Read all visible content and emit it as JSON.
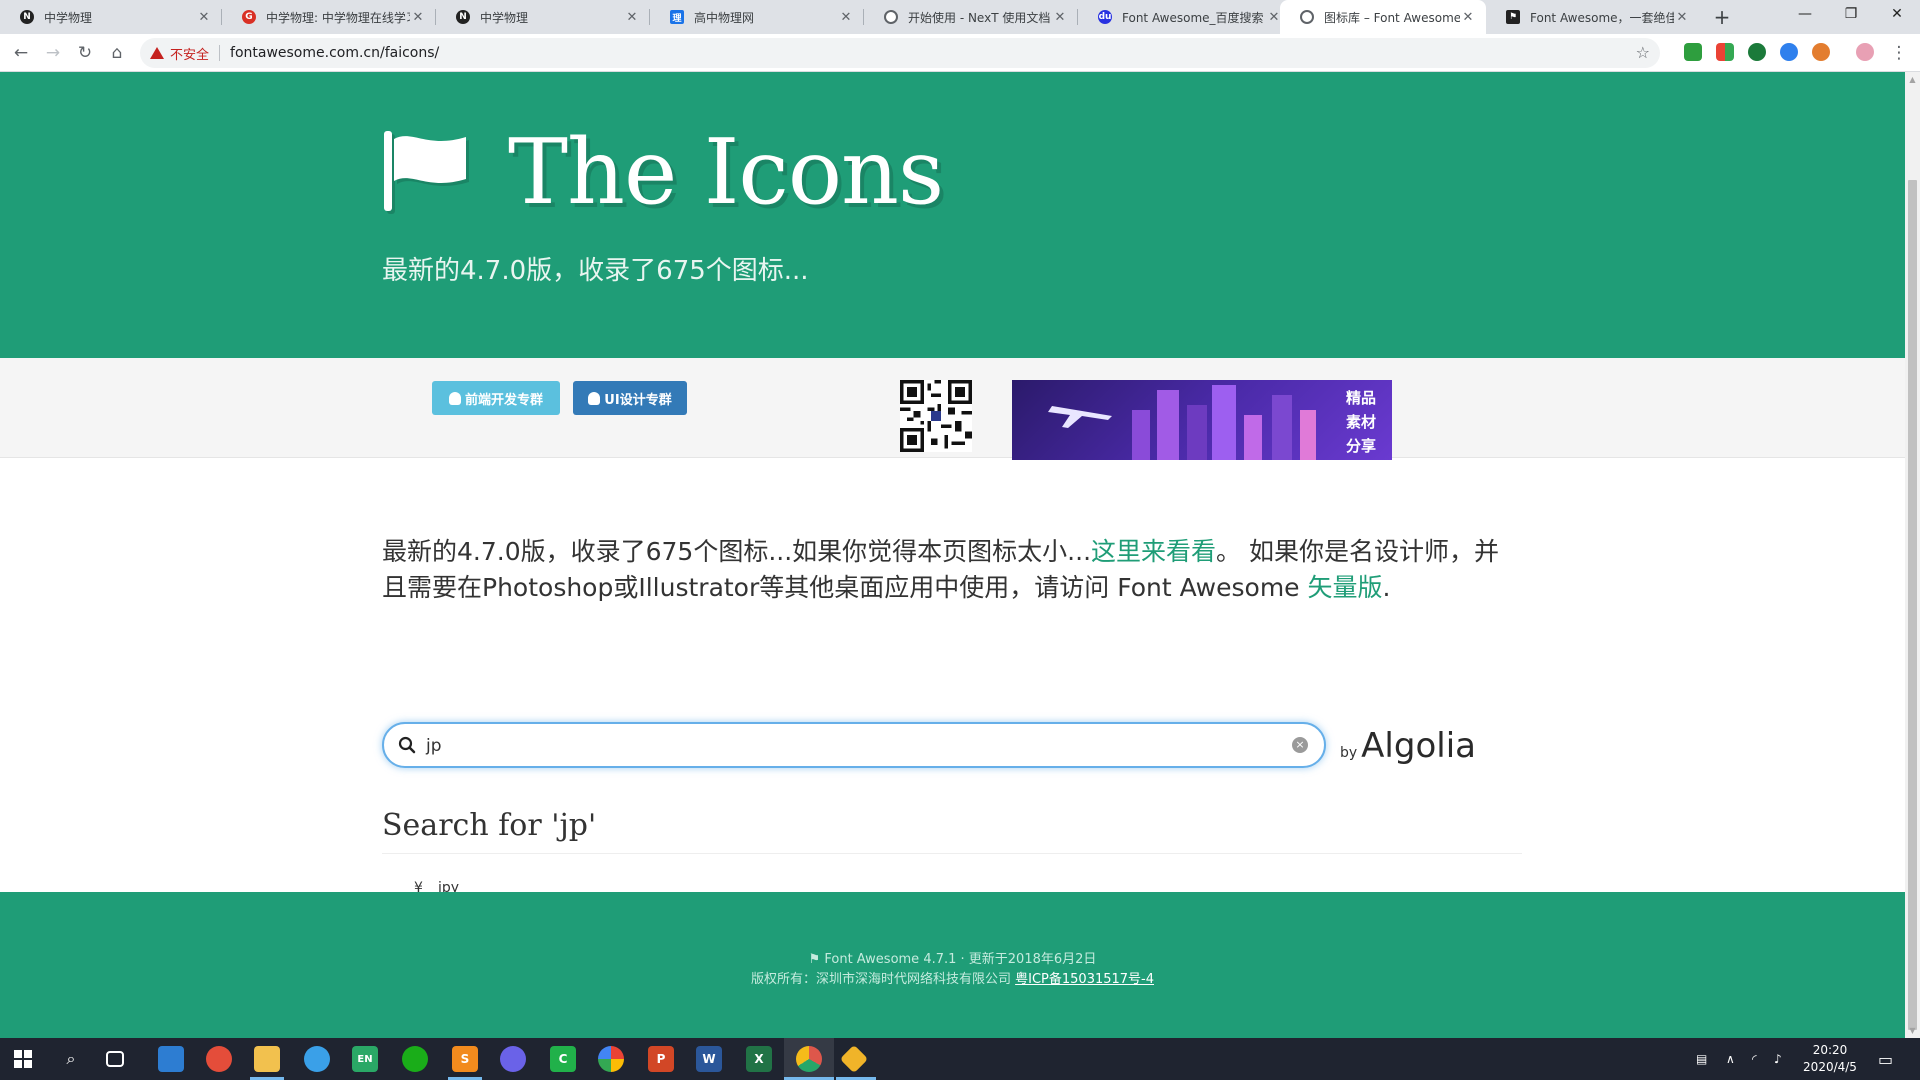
{
  "browser": {
    "tabs": [
      {
        "label": "中学物理",
        "favicon": "notion-icon",
        "color": "#222222"
      },
      {
        "label": "中学物理: 中学物理在线学习",
        "favicon": "g-icon",
        "color": "#d93025"
      },
      {
        "label": "中学物理",
        "favicon": "notion-icon",
        "color": "#222222"
      },
      {
        "label": "高中物理网",
        "favicon": "site-icon",
        "color": "#1a73e8"
      },
      {
        "label": "开始使用 - NexT 使用文档",
        "favicon": "globe-icon",
        "color": "#5f6368"
      },
      {
        "label": "Font Awesome_百度搜索",
        "favicon": "baidu-icon",
        "color": "#2932e1"
      },
      {
        "label": "图标库 – Font Awesome 中",
        "favicon": "globe-icon",
        "color": "#5f6368",
        "active": true
      },
      {
        "label": "Font Awesome，一套绝佳",
        "favicon": "flag-icon",
        "color": "#222222"
      }
    ],
    "new_tab": "+",
    "window_controls": {
      "minimize": "—",
      "maximize": "❐",
      "close": "✕"
    },
    "security_label": "不安全",
    "url": "fontawesome.com.cn/faicons/"
  },
  "page": {
    "title": "The Icons",
    "subtitle": "最新的4.7.0版，收录了675个图标...",
    "group_buttons": [
      {
        "label": "前端开发专群",
        "color": "#5bc0de"
      },
      {
        "label": "UI设计专群",
        "color": "#337ab7"
      }
    ],
    "banner_text": [
      "精品",
      "素材",
      "分享"
    ],
    "intro": {
      "part1": "最新的4.7.0版，收录了675个图标...如果你觉得本页图标太小...",
      "link1": "这里来看看",
      "part2": "。 如果你是名设计师，并且需要在Photoshop或Illustrator等其他桌面应用中使用，请访问 Font Awesome ",
      "link2": "矢量版",
      "part3": "."
    },
    "search": {
      "value": "jp",
      "clear_label": "×"
    },
    "algolia": {
      "by": "by",
      "brand": "Algolia"
    },
    "results_title": "Search for 'jp'",
    "results": [
      {
        "glyph": "¥",
        "name": "jpy"
      }
    ],
    "footer": {
      "line1": "Font Awesome 4.7.1 · 更新于2018年6月2日",
      "line2_prefix": "版权所有：深圳市深海时代网络科技有限公司",
      "icp": "粤ICP备15031517号-4"
    }
  },
  "taskbar": {
    "clock_time": "20:20",
    "clock_date": "2020/4/5"
  }
}
